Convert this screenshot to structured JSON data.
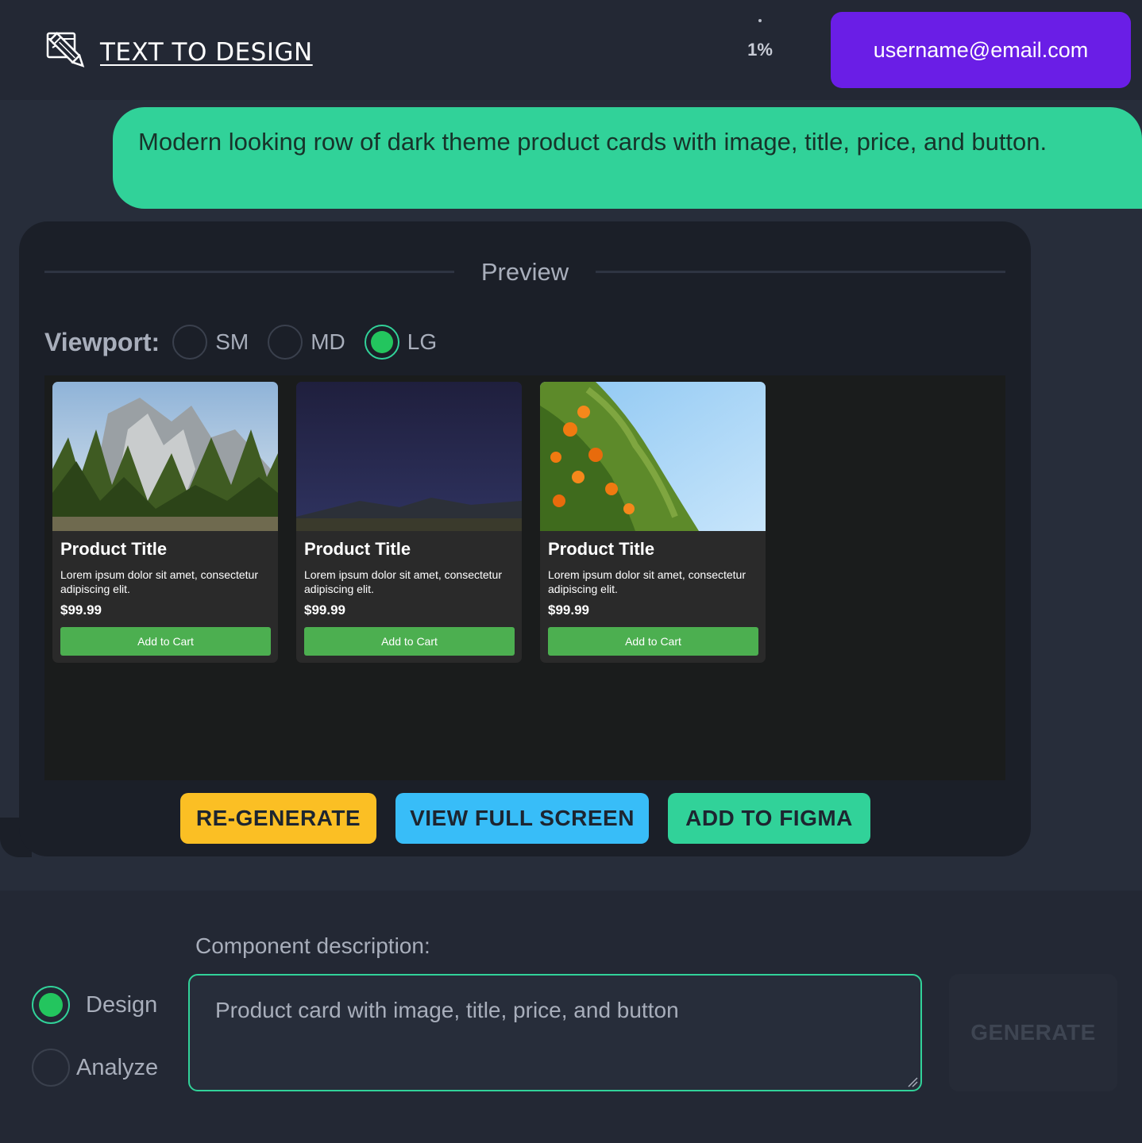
{
  "header": {
    "app_title": "TEXT TO DESIGN",
    "progress": "1%",
    "user_email": "username@email.com"
  },
  "chat": {
    "prompt": "Modern looking row of dark theme product cards with image, title, price, and button."
  },
  "preview": {
    "title": "Preview",
    "viewport_label": "Viewport:",
    "viewports": [
      {
        "label": "SM",
        "selected": false
      },
      {
        "label": "MD",
        "selected": false
      },
      {
        "label": "LG",
        "selected": true
      }
    ],
    "cards": [
      {
        "image": "mountain-forest-image",
        "title": "Product Title",
        "description": "Lorem ipsum dolor sit amet, consectetur adipiscing elit.",
        "price": "$99.99",
        "button": "Add to Cart"
      },
      {
        "image": "night-sky-image",
        "title": "Product Title",
        "description": "Lorem ipsum dolor sit amet, consectetur adipiscing elit.",
        "price": "$99.99",
        "button": "Add to Cart"
      },
      {
        "image": "orange-tree-image",
        "title": "Product Title",
        "description": "Lorem ipsum dolor sit amet, consectetur adipiscing elit.",
        "price": "$99.99",
        "button": "Add to Cart"
      }
    ],
    "actions": {
      "regenerate": "RE-GENERATE",
      "view_full_screen": "VIEW FULL SCREEN",
      "add_to_figma": "ADD TO FIGMA"
    }
  },
  "composer": {
    "modes": [
      {
        "label": "Design",
        "selected": true
      },
      {
        "label": "Analyze",
        "selected": false
      }
    ],
    "description_label": "Component description:",
    "placeholder": "Product card with image, title, price, and button",
    "generate_label": "GENERATE"
  },
  "colors": {
    "accent_purple": "#6a1ee6",
    "accent_green": "#31d299",
    "accent_yellow": "#fbbf24",
    "accent_blue": "#38bdf8",
    "card_button": "#4caf50"
  }
}
